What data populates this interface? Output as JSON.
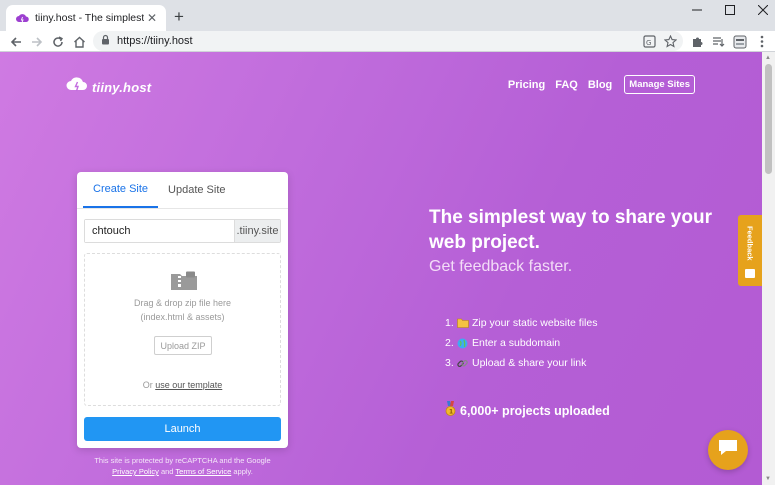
{
  "browser": {
    "tab_title": "tiiny.host - The simplest way to",
    "url": "https://tiiny.host",
    "new_tab": "+",
    "tab_close": "✕"
  },
  "header": {
    "logo_text": "tiiny.host",
    "nav": [
      "Pricing",
      "FAQ",
      "Blog"
    ],
    "manage_button": "Manage Sites"
  },
  "card": {
    "tabs": [
      "Create Site",
      "Update Site"
    ],
    "subdomain_value": "chtouch",
    "subdomain_suffix": ".tiiny.site",
    "dropzone_line1": "Drag & drop zip file here",
    "dropzone_line2": "(index.html & assets)",
    "upload_button": "Upload ZIP",
    "template_prefix": "Or",
    "template_link": "use our template",
    "launch_button": "Launch"
  },
  "recaptcha": {
    "line1": "This site is protected by reCAPTCHA and the Google",
    "privacy": "Privacy Policy",
    "and": "and",
    "terms": "Terms of Service",
    "apply": "apply."
  },
  "hero": {
    "title": "The simplest way to share your web project.",
    "subtitle": "Get feedback faster.",
    "steps": [
      {
        "num": "1.",
        "text": "Zip your static website files"
      },
      {
        "num": "2.",
        "text": "Enter a subdomain"
      },
      {
        "num": "3.",
        "text": "Upload & share your link"
      }
    ],
    "projects": "6,000+ projects uploaded"
  },
  "widgets": {
    "feedback_label": "Feedback"
  },
  "colors": {
    "accent": "#2196f3",
    "widget": "#e6a21c",
    "bg_start": "#cf7ae2",
    "bg_end": "#b35bd3"
  }
}
